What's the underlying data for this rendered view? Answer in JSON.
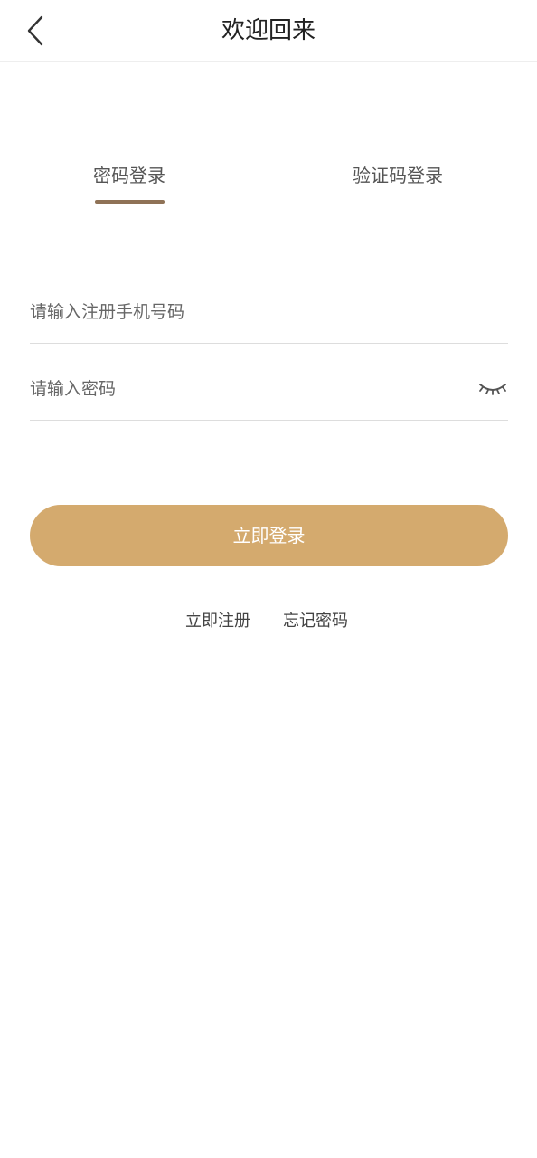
{
  "header": {
    "title": "欢迎回来",
    "back_icon": "chevron-left-icon"
  },
  "tabs": [
    {
      "label": "密码登录",
      "active": true
    },
    {
      "label": "验证码登录",
      "active": false
    }
  ],
  "form": {
    "phone": {
      "value": "",
      "placeholder": "请输入注册手机号码"
    },
    "password": {
      "value": "",
      "placeholder": "请输入密码",
      "toggle_icon": "eye-closed-icon"
    }
  },
  "actions": {
    "login_label": "立即登录",
    "register_label": "立即注册",
    "forgot_label": "忘记密码"
  },
  "colors": {
    "accent": "#d4aa6e",
    "tab_underline": "#8f7256"
  }
}
